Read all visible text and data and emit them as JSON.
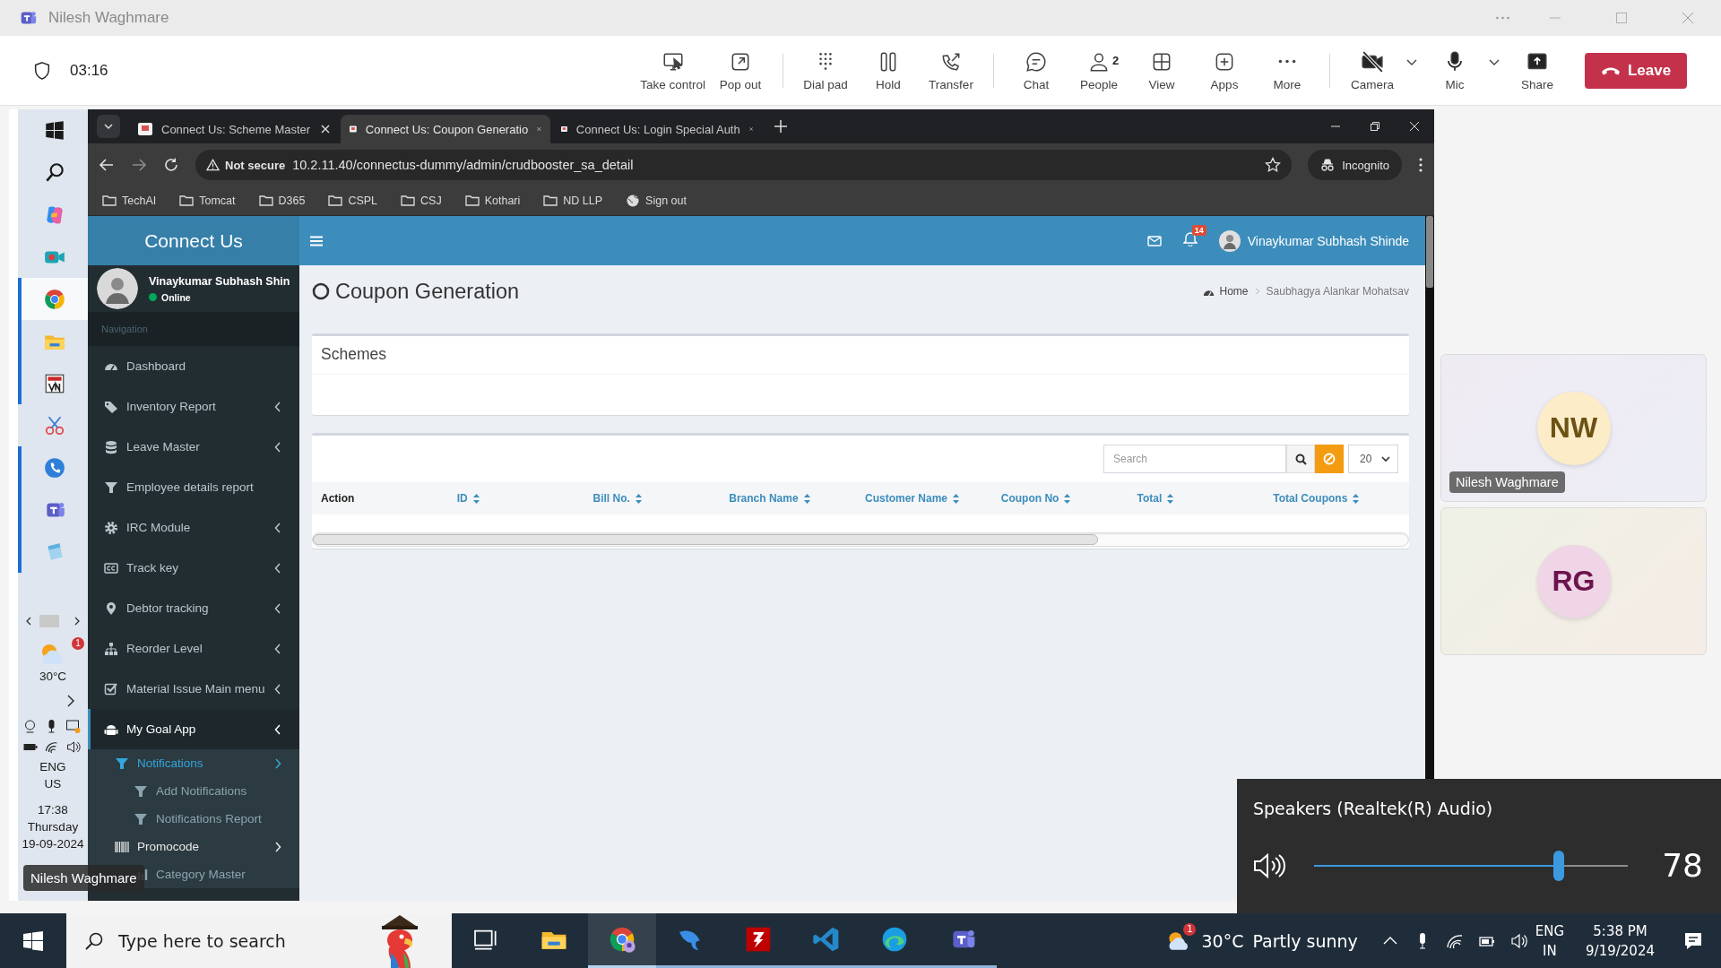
{
  "meeting": {
    "title": "Nilesh Waghmare",
    "timer": "03:16",
    "tool_groups": [
      [
        {
          "label": "Take control"
        },
        {
          "label": "Pop out"
        }
      ],
      [
        {
          "label": "Dial pad"
        },
        {
          "label": "Hold"
        },
        {
          "label": "Transfer"
        }
      ],
      [
        {
          "label": "Chat"
        },
        {
          "label": "People",
          "badge": "2"
        },
        {
          "label": "View"
        },
        {
          "label": "Apps"
        },
        {
          "label": "More"
        }
      ]
    ],
    "devices": [
      {
        "label": "Camera",
        "on": false
      },
      {
        "label": "Mic",
        "on": true
      }
    ],
    "share": "Share",
    "leave": "Leave"
  },
  "remote_desktop": {
    "taskbar": {
      "apps": [
        {
          "running": false,
          "selected": false
        },
        {
          "running": false,
          "selected": false
        },
        {
          "running": false,
          "selected": false
        },
        {
          "running": false,
          "selected": false
        },
        {
          "running": true,
          "selected": true
        },
        {
          "running": true,
          "selected": false
        },
        {
          "running": true,
          "selected": false
        },
        {
          "running": false,
          "selected": false
        },
        {
          "running": true,
          "selected": false
        },
        {
          "running": true,
          "selected": false
        },
        {
          "running": true,
          "selected": false
        }
      ],
      "weather": {
        "temp": "30°C",
        "badge": "1"
      },
      "language": "ENG",
      "region": "US",
      "time": "17:38",
      "day": "Thursday",
      "date": "19-09-2024"
    },
    "presenter_label": "Nilesh Waghmare",
    "browser": {
      "tabs": [
        {
          "title": "Connect Us: Scheme Master",
          "selected": false
        },
        {
          "title": "Connect Us: Coupon Generatio",
          "selected": true
        },
        {
          "title": "Connect Us: Login Special Auth",
          "selected": false
        }
      ],
      "security": "Not secure",
      "url": "10.2.11.40/connectus-dummy/admin/crudbooster_sa_detail",
      "profile": "Incognito",
      "bookmarks": [
        {
          "label": "TechAI",
          "kind": "folder"
        },
        {
          "label": "Tomcat",
          "kind": "folder"
        },
        {
          "label": "D365",
          "kind": "folder"
        },
        {
          "label": "CSPL",
          "kind": "folder"
        },
        {
          "label": "CSJ",
          "kind": "folder"
        },
        {
          "label": "Kothari",
          "kind": "folder"
        },
        {
          "label": "ND LLP",
          "kind": "folder"
        },
        {
          "label": "Sign out",
          "kind": "link"
        }
      ],
      "app": {
        "brand": "Connect Us",
        "user": {
          "name": "Vinaykumar Subhash Shin",
          "status": "Online"
        },
        "nav_heading": "Navigation",
        "menu": [
          {
            "label": "Dashboard",
            "expandable": false,
            "active": false
          },
          {
            "label": "Inventory Report",
            "expandable": true,
            "active": false
          },
          {
            "label": "Leave Master",
            "expandable": true,
            "active": false
          },
          {
            "label": "Employee details report",
            "expandable": false,
            "active": false
          },
          {
            "label": "IRC Module",
            "expandable": true,
            "active": false
          },
          {
            "label": "Track key",
            "expandable": true,
            "active": false
          },
          {
            "label": "Debtor tracking",
            "expandable": true,
            "active": false
          },
          {
            "label": "Reorder Level",
            "expandable": true,
            "active": false
          },
          {
            "label": "Material Issue Main menu",
            "expandable": true,
            "active": false
          },
          {
            "label": "My Goal App",
            "expandable": true,
            "active": true,
            "children": [
              {
                "label": "Notifications",
                "expandable": true,
                "active": true,
                "children": [
                  {
                    "label": "Add Notifications",
                    "expandable": false,
                    "active": false
                  },
                  {
                    "label": "Notifications Report",
                    "expandable": false,
                    "active": false
                  }
                ]
              },
              {
                "label": "Promocode",
                "expandable": true,
                "active": false,
                "children": [
                  {
                    "label": "Category Master",
                    "expandable": false,
                    "active": false
                  }
                ]
              }
            ]
          }
        ],
        "header": {
          "notifications": "14",
          "user": "Vinaykumar Subhash Shinde"
        },
        "page_title": "Coupon Generation",
        "breadcrumb": [
          "Home",
          "Saubhagya Alankar Mohatsav"
        ],
        "schemes_box": {
          "title": "Schemes"
        },
        "table": {
          "search": {
            "placeholder": "Search"
          },
          "page_size": "20",
          "columns": [
            {
              "label": "Action",
              "sortable": false
            },
            {
              "label": "ID",
              "sortable": true
            },
            {
              "label": "Bill No.",
              "sortable": true
            },
            {
              "label": "Branch Name",
              "sortable": true
            },
            {
              "label": "Customer Name",
              "sortable": true
            },
            {
              "label": "Coupon No",
              "sortable": true
            },
            {
              "label": "Total",
              "sortable": true
            },
            {
              "label": "Total Coupons",
              "sortable": true
            }
          ]
        }
      }
    }
  },
  "participants": [
    {
      "initials": "NW",
      "name": "Nilesh Waghmare",
      "color": "#fcecc8"
    },
    {
      "initials": "RG",
      "color": "#efd5e6"
    }
  ],
  "volume": {
    "device": "Speakers (Realtek(R) Audio)",
    "level": 0.78,
    "reading": "78"
  },
  "taskbar": {
    "search": {
      "placeholder": "Type here to search"
    },
    "apps": [
      {
        "running": false,
        "selected": false
      },
      {
        "running": false,
        "selected": false
      },
      {
        "running": true,
        "selected": true
      },
      {
        "running": true,
        "selected": false
      },
      {
        "running": true,
        "selected": false
      },
      {
        "running": true,
        "selected": false
      },
      {
        "running": true,
        "selected": false
      },
      {
        "running": true,
        "selected": false
      }
    ],
    "weather": {
      "temp": "30°C",
      "condition": "Partly sunny",
      "badge": "1"
    },
    "language": "ENG",
    "region": "IN",
    "time": "5:38 PM",
    "date": "9/19/2024"
  }
}
